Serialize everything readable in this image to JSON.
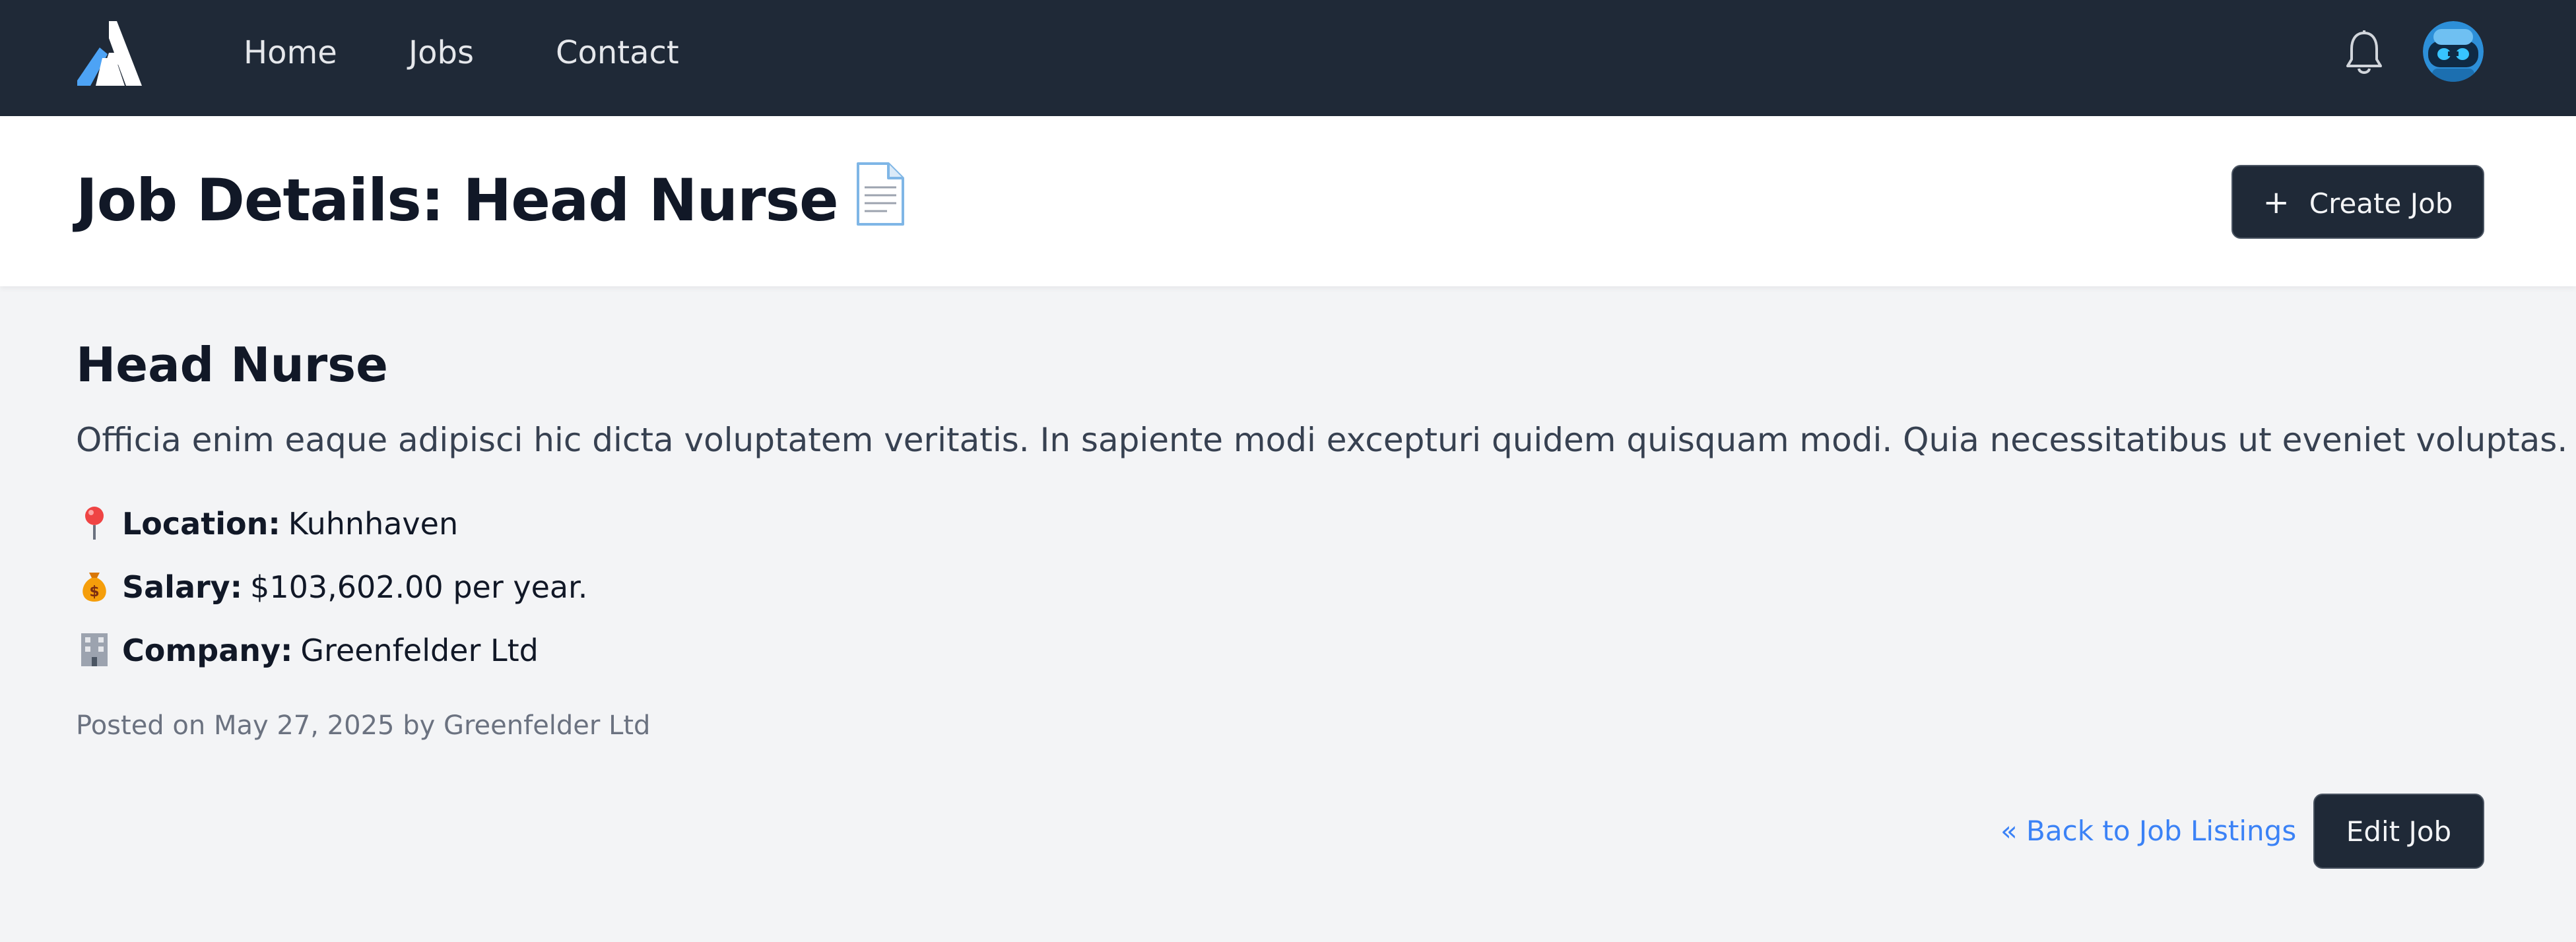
{
  "nav": {
    "links": [
      "Home",
      "Jobs",
      "Contact"
    ],
    "logo_icon": "brand-logo-a",
    "notification_icon": "bell-icon",
    "avatar_icon": "robot-avatar"
  },
  "header": {
    "title": "Job Details: Head Nurse",
    "title_icon": "document-icon",
    "create_button": "Create Job",
    "create_icon": "plus-icon"
  },
  "job": {
    "title": "Head Nurse",
    "description": "Officia enim eaque adipisci hic dicta voluptatem veritatis. In sapiente modi excepturi quidem quisquam modi. Quia necessitatibus ut eveniet voluptas.",
    "location_label": "Location:",
    "location_value": "Kuhnhaven",
    "location_icon": "pin-icon",
    "salary_label": "Salary:",
    "salary_value": "$103,602.00 per year.",
    "salary_icon": "money-bag-icon",
    "company_label": "Company:",
    "company_value": "Greenfelder Ltd",
    "company_icon": "office-building-icon",
    "posted": "Posted on May 27, 2025 by Greenfelder Ltd"
  },
  "actions": {
    "back_link": "« Back to Job Listings",
    "edit_button": "Edit Job"
  },
  "colors": {
    "nav_bg": "#1f2937",
    "page_bg": "#f3f4f6",
    "link": "#3b82f6",
    "button_bg": "#1f2937"
  }
}
